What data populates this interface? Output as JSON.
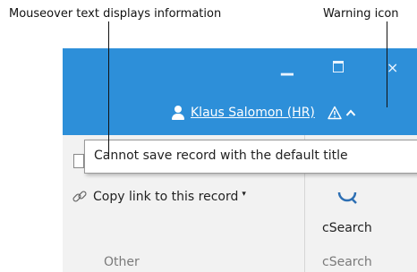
{
  "callouts": {
    "mouseover_text": "Mouseover text displays information",
    "warning_icon": "Warning icon"
  },
  "titlebar": {
    "minimize_icon": "minimize-icon",
    "maximize_icon": "maximize-icon",
    "close_icon": "close-icon",
    "close_glyph": "×",
    "background": "#2d8fd9"
  },
  "user": {
    "name": "Klaus Salomon (HR)",
    "icon": "user-icon"
  },
  "tooltip": {
    "text": "Cannot save record with the default title"
  },
  "ribbon": {
    "copy_link_label": "Copy link to this record",
    "copy_link_caret": "▾",
    "csearch_button_label": "cSearch",
    "groups": [
      "Other",
      "cSearch"
    ]
  }
}
